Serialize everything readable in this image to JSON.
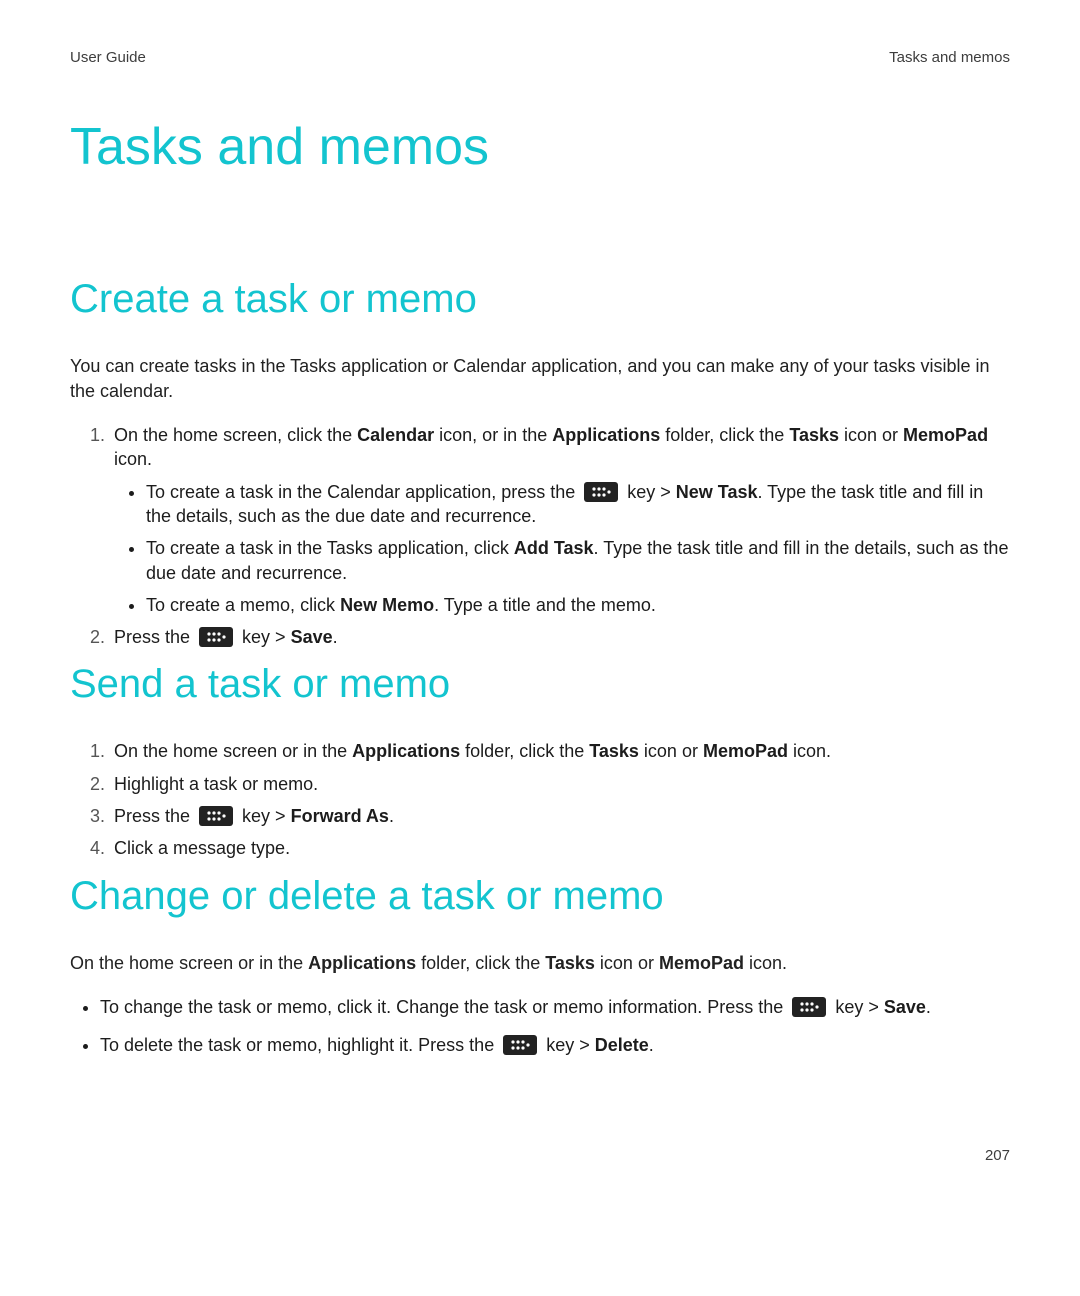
{
  "header": {
    "left": "User Guide",
    "right": "Tasks and memos"
  },
  "title": "Tasks and memos",
  "sections": {
    "create": {
      "heading": "Create a task or memo",
      "intro": "You can create tasks in the Tasks application or Calendar application, and you can make any of your tasks visible in the calendar.",
      "step1": {
        "pre": "On the home screen, click the ",
        "b1": "Calendar",
        "mid1": " icon, or in the ",
        "b2": "Applications",
        "mid2": " folder, click the ",
        "b3": "Tasks",
        "mid3": " icon or ",
        "b4": "MemoPad",
        "post": " icon."
      },
      "bullets": {
        "a": {
          "pre": "To create a task in the Calendar application, press the ",
          "key_after": " key > ",
          "b": "New Task",
          "post": ". Type the task title and fill in the details, such as the due date and recurrence."
        },
        "b_": {
          "pre": "To create a task in the Tasks application, click ",
          "b": "Add Task",
          "post": ". Type the task title and fill in the details, such as the due date and recurrence."
        },
        "c": {
          "pre": "To create a memo, click ",
          "b": "New Memo",
          "post": ". Type a title and the memo."
        }
      },
      "step2": {
        "pre": "Press the ",
        "key_after": " key > ",
        "b": "Save",
        "post": "."
      }
    },
    "send": {
      "heading": "Send a task or memo",
      "step1": {
        "pre": "On the home screen or in the ",
        "b1": "Applications",
        "mid1": " folder, click the ",
        "b2": "Tasks",
        "mid2": " icon or ",
        "b3": "MemoPad",
        "post": " icon."
      },
      "step2": "Highlight a task or memo.",
      "step3": {
        "pre": "Press the ",
        "key_after": " key > ",
        "b": "Forward As",
        "post": "."
      },
      "step4": "Click a message type."
    },
    "change": {
      "heading": "Change or delete a task or memo",
      "intro": {
        "pre": "On the home screen or in the ",
        "b1": "Applications",
        "mid1": " folder, click the ",
        "b2": "Tasks",
        "mid2": " icon or ",
        "b3": "MemoPad",
        "post": " icon."
      },
      "bullet1": {
        "pre": "To change the task or memo, click it. Change the task or memo information. Press the ",
        "key_after": " key > ",
        "b": "Save",
        "post": "."
      },
      "bullet2": {
        "pre": "To delete the task or memo, highlight it. Press the ",
        "key_after": " key > ",
        "b": "Delete",
        "post": "."
      }
    }
  },
  "page_number": "207",
  "colors": {
    "accent": "#13c4cf"
  }
}
